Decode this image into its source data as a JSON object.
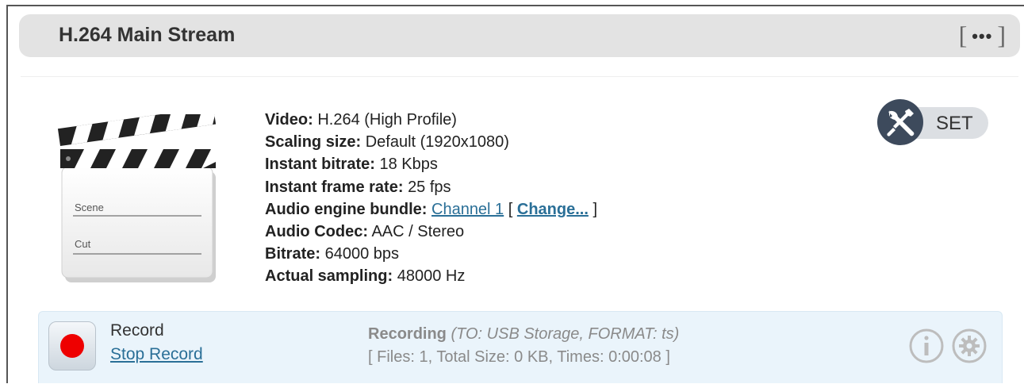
{
  "header": {
    "title": "H.264 Main Stream",
    "menu_icon": "ellipsis-icon"
  },
  "clapper": {
    "scene_label": "Scene",
    "cut_label": "Cut"
  },
  "info": {
    "video_label": "Video:",
    "video_value": "H.264 (High Profile)",
    "scaling_label": "Scaling size:",
    "scaling_value": "Default (1920x1080)",
    "bitrate_label": "Instant bitrate:",
    "bitrate_value": "18 Kbps",
    "framerate_label": "Instant frame rate:",
    "framerate_value": "25 fps",
    "audio_bundle_label": "Audio engine bundle:",
    "audio_bundle_link": "Channel 1",
    "change_link": "Change...",
    "audio_codec_label": "Audio Codec:",
    "audio_codec_value": "AAC / Stereo",
    "audio_bitrate_label": "Bitrate:",
    "audio_bitrate_value": "64000 bps",
    "sampling_label": "Actual sampling:",
    "sampling_value": "48000 Hz"
  },
  "set_button": {
    "label": "SET",
    "icon": "tools-icon"
  },
  "record": {
    "title": "Record",
    "stop_link": "Stop Record",
    "status_label": "Recording",
    "status_detail": "(TO: USB Storage, FORMAT: ts)",
    "stats": "[ Files: 1, Total Size: 0 KB, Times: 0:00:08 ]",
    "record_color": "#ee0000"
  }
}
